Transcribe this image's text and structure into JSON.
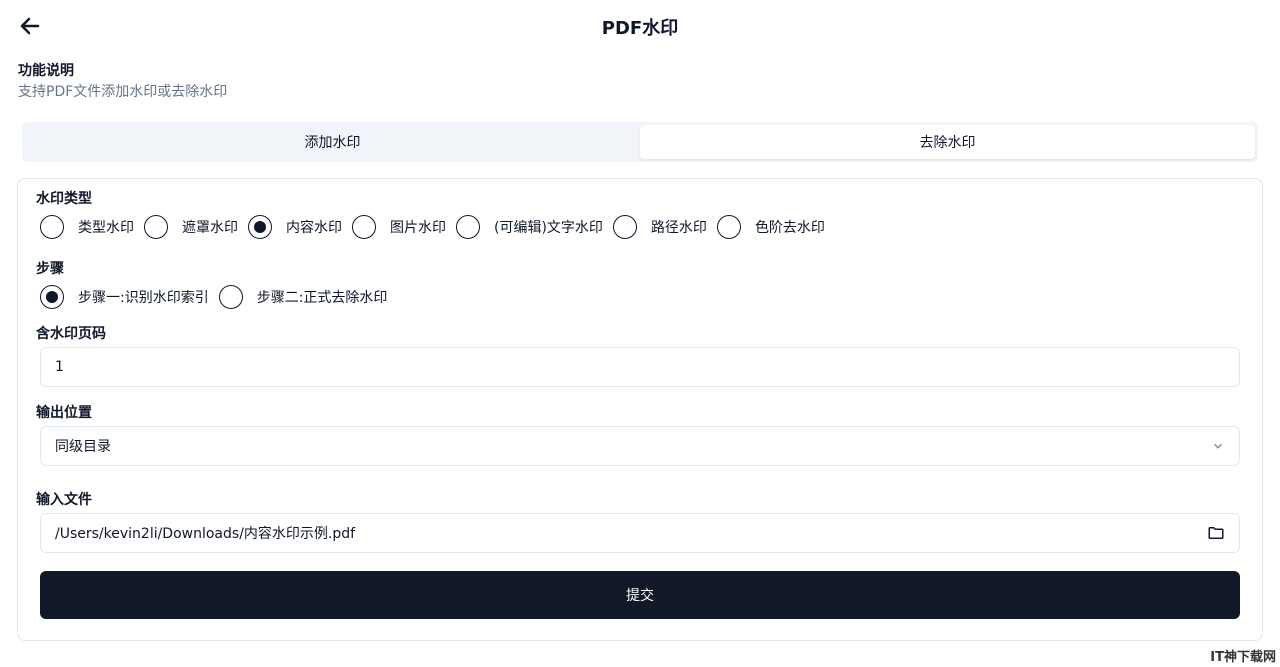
{
  "header": {
    "title": "PDF水印"
  },
  "description": {
    "heading": "功能说明",
    "text": "支持PDF文件添加水印或去除水印"
  },
  "tabs": [
    {
      "label": "添加水印",
      "active": false
    },
    {
      "label": "去除水印",
      "active": true
    }
  ],
  "form": {
    "type_label": "水印类型",
    "types": [
      "类型水印",
      "遮罩水印",
      "内容水印",
      "图片水印",
      "(可编辑)文字水印",
      "路径水印",
      "色阶去水印"
    ],
    "selected_type": "内容水印",
    "step_label": "步骤",
    "steps": [
      "步骤一:识别水印索引",
      "步骤二:正式去除水印"
    ],
    "selected_step": "步骤一:识别水印索引",
    "pages_label": "含水印页码",
    "pages_value": "1",
    "output_label": "输出位置",
    "output_value": "同级目录",
    "input_label": "输入文件",
    "input_value": "/Users/kevin2li/Downloads/内容水印示例.pdf",
    "submit_label": "提交"
  },
  "watermark": "IT神下载网"
}
